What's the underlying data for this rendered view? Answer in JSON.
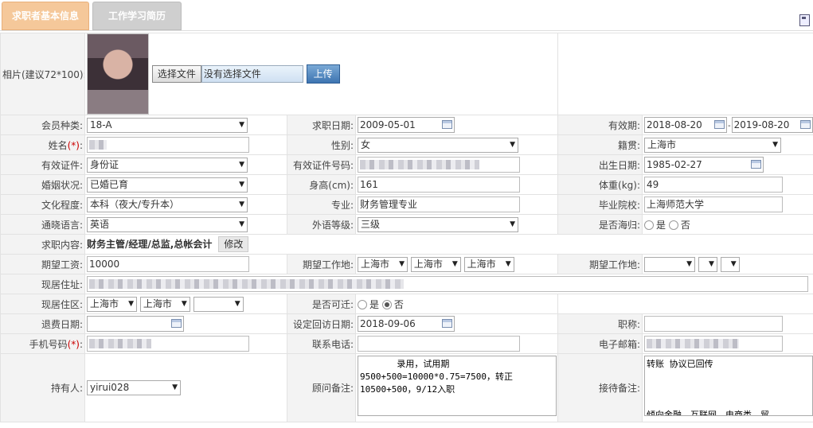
{
  "tabs": [
    "求职者基本信息",
    "工作学习简历"
  ],
  "photo": {
    "label": "相片(建议72*100):",
    "file_button": "选择文件",
    "file_name": "没有选择文件",
    "upload": "上传"
  },
  "member_type": {
    "label": "会员种类:",
    "value": "18-A"
  },
  "job_date": {
    "label": "求职日期:",
    "value": "2009-05-01"
  },
  "valid": {
    "label": "有效期:",
    "from": "2018-08-20",
    "sep": "-",
    "to": "2019-08-20"
  },
  "name": {
    "label": "姓名",
    "req": "(*)",
    "colon": ":"
  },
  "gender": {
    "label": "性别:",
    "value": "女"
  },
  "native": {
    "label": "籍贯:",
    "value": "上海市"
  },
  "id_type": {
    "label": "有效证件:",
    "value": "身份证"
  },
  "id_no": {
    "label": "有效证件号码:"
  },
  "birth": {
    "label": "出生日期:",
    "value": "1985-02-27"
  },
  "marriage": {
    "label": "婚姻状况:",
    "value": "已婚已育"
  },
  "height": {
    "label": "身高(cm):",
    "value": "161"
  },
  "weight": {
    "label": "体重(kg):",
    "value": "49"
  },
  "education": {
    "label": "文化程度:",
    "value": "本科（夜大/专升本）"
  },
  "major": {
    "label": "专业:",
    "value": "财务管理专业"
  },
  "school": {
    "label": "毕业院校:",
    "value": "上海师范大学"
  },
  "language": {
    "label": "通晓语言:",
    "value": "英语"
  },
  "foreign_level": {
    "label": "外语等级:",
    "value": "三级"
  },
  "returnee": {
    "label": "是否海归:",
    "yes": "是",
    "no": "否"
  },
  "job_content": {
    "label": "求职内容:",
    "value": "财务主管/经理/总监,总帐会计",
    "modify": "修改"
  },
  "salary": {
    "label": "期望工资:",
    "value": "10000"
  },
  "work_place1": {
    "label": "期望工作地:",
    "v1": "上海市",
    "v2": "上海市",
    "v3": "上海市"
  },
  "work_place2": {
    "label": "期望工作地:"
  },
  "address": {
    "label": "现居住址:"
  },
  "district": {
    "label": "现居住区:",
    "v1": "上海市",
    "v2": "上海市"
  },
  "relocate": {
    "label": "是否可迁:",
    "yes": "是",
    "no": "否"
  },
  "refund": {
    "label": "退费日期:"
  },
  "revisit": {
    "label": "设定回访日期:",
    "value": "2018-09-06"
  },
  "title": {
    "label": "职称:"
  },
  "mobile": {
    "label": "手机号码",
    "req": "(*)",
    "colon": ":"
  },
  "phone": {
    "label": "联系电话:"
  },
  "email": {
    "label": "电子邮箱:"
  },
  "holder": {
    "label": "持有人:",
    "value": "yirui028"
  },
  "consultant_note": {
    "label": "顾问备注:",
    "text": "       录用，试用期\n9500+500=10000*0.75=7500，转正\n10500+500，9/12入职"
  },
  "reception_note": {
    "label": "接待备注:",
    "text": "转账 协议已回传\n\n\n\n倾向金融，互联网，电商类，贸"
  }
}
